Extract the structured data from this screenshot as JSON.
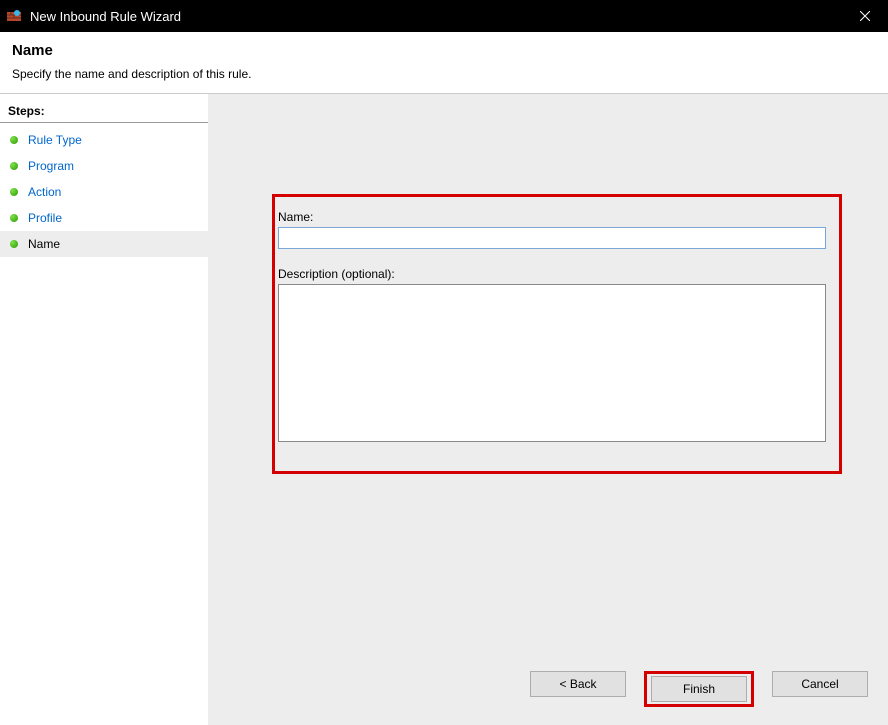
{
  "window": {
    "title": "New Inbound Rule Wizard"
  },
  "header": {
    "title": "Name",
    "subtitle": "Specify the name and description of this rule."
  },
  "sidebar": {
    "header": "Steps:",
    "items": [
      {
        "label": "Rule Type",
        "link": true
      },
      {
        "label": "Program",
        "link": true
      },
      {
        "label": "Action",
        "link": true
      },
      {
        "label": "Profile",
        "link": true
      },
      {
        "label": "Name",
        "link": false,
        "current": true
      }
    ]
  },
  "form": {
    "name_label": "Name:",
    "name_value": "",
    "description_label": "Description (optional):",
    "description_value": ""
  },
  "buttons": {
    "back": "< Back",
    "finish": "Finish",
    "cancel": "Cancel"
  }
}
